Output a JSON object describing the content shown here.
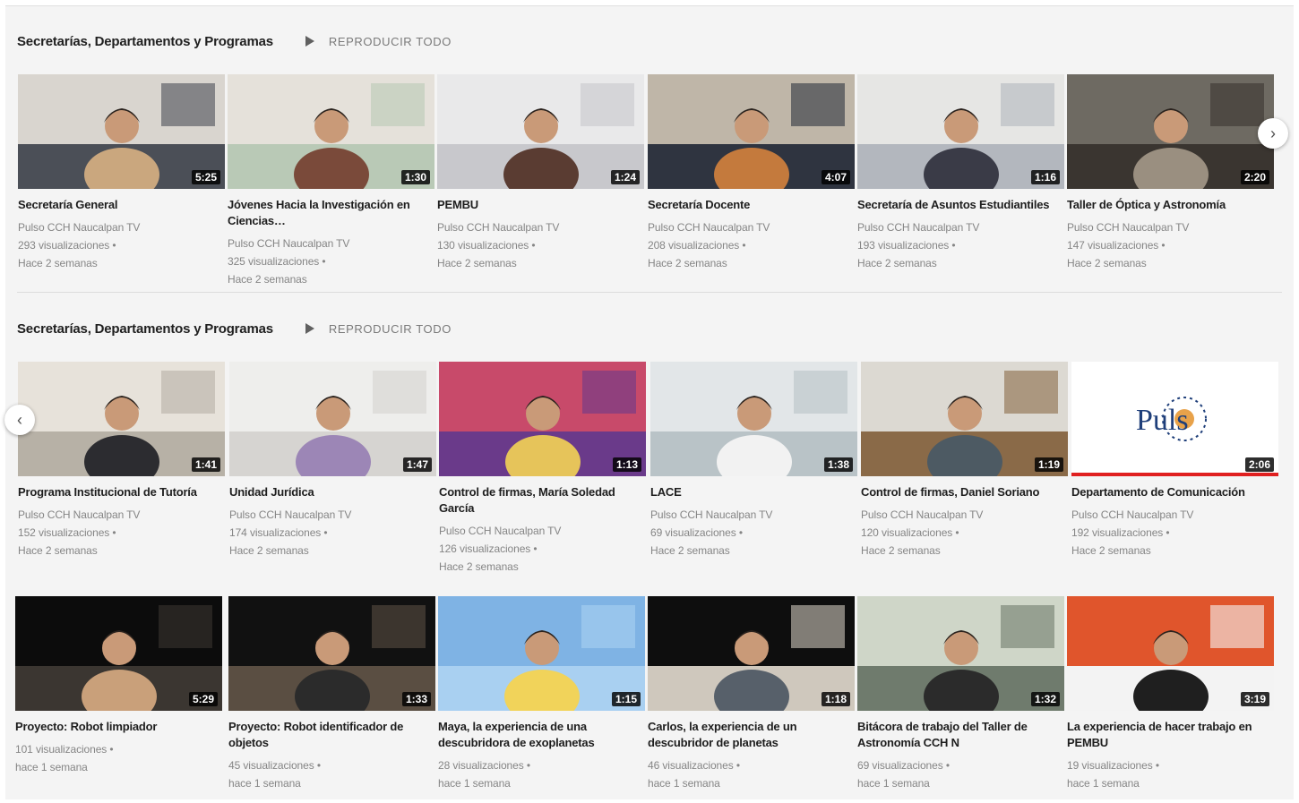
{
  "shelves": [
    {
      "title": "Secretarías, Departamentos y Programas",
      "play_all": "REPRODUCIR TODO",
      "rows": [
        [
          {
            "title": "Secretaría General",
            "channel": "Pulso CCH Naucalpan TV",
            "views": "293 visualizaciones •",
            "age": "Hace 2 semanas",
            "duration": "5:25"
          },
          {
            "title": "Jóvenes Hacia la Investigación en Ciencias…",
            "channel": "Pulso CCH Naucalpan TV",
            "views": "325 visualizaciones •",
            "age": "Hace 2 semanas",
            "duration": "1:30"
          },
          {
            "title": "PEMBU",
            "channel": "Pulso CCH Naucalpan TV",
            "views": "130 visualizaciones •",
            "age": "Hace 2 semanas",
            "duration": "1:24"
          },
          {
            "title": "Secretaría Docente",
            "channel": "Pulso CCH Naucalpan TV",
            "views": "208 visualizaciones •",
            "age": "Hace 2 semanas",
            "duration": "4:07"
          },
          {
            "title": "Secretaría de Asuntos Estudiantiles",
            "channel": "Pulso CCH Naucalpan TV",
            "views": "193 visualizaciones •",
            "age": "Hace 2 semanas",
            "duration": "1:16"
          },
          {
            "title": "Taller de Óptica y Astronomía",
            "channel": "Pulso CCH Naucalpan TV",
            "views": "147 visualizaciones •",
            "age": "Hace 2 semanas",
            "duration": "2:20"
          }
        ]
      ]
    },
    {
      "title": "Secretarías, Departamentos y Programas",
      "play_all": "REPRODUCIR TODO",
      "rows": [
        [
          {
            "title": "Programa Institucional de Tutoría",
            "channel": "Pulso CCH Naucalpan TV",
            "views": "152 visualizaciones •",
            "age": "Hace 2 semanas",
            "duration": "1:41"
          },
          {
            "title": "Unidad Jurídica",
            "channel": "Pulso CCH Naucalpan TV",
            "views": "174 visualizaciones •",
            "age": "Hace 2 semanas",
            "duration": "1:47"
          },
          {
            "title": "Control de firmas, María Soledad García",
            "channel": "Pulso CCH Naucalpan TV",
            "views": "126 visualizaciones •",
            "age": "Hace 2 semanas",
            "duration": "1:13"
          },
          {
            "title": "LACE",
            "channel": "Pulso CCH Naucalpan TV",
            "views": "69 visualizaciones •",
            "age": "Hace 2 semanas",
            "duration": "1:38"
          },
          {
            "title": "Control de firmas, Daniel Soriano",
            "channel": "Pulso CCH Naucalpan TV",
            "views": "120 visualizaciones •",
            "age": "Hace 2 semanas",
            "duration": "1:19"
          },
          {
            "title": "Departamento de Comunicación",
            "channel": "Pulso CCH Naucalpan TV",
            "views": "192 visualizaciones •",
            "age": "Hace 2 semanas",
            "duration": "2:06",
            "logo": "Puls",
            "progress": 1.0
          }
        ],
        [
          {
            "title": "Proyecto: Robot limpiador",
            "views": "101 visualizaciones •",
            "age": "hace 1 semana",
            "duration": "5:29"
          },
          {
            "title": "Proyecto: Robot identificador de objetos",
            "views": "45 visualizaciones •",
            "age": "hace 1 semana",
            "duration": "1:33"
          },
          {
            "title": "Maya, la experiencia de una descubridora de exoplanetas",
            "views": "28 visualizaciones •",
            "age": "hace 1 semana",
            "duration": "1:15"
          },
          {
            "title": "Carlos, la experiencia de un descubridor de planetas",
            "views": "46 visualizaciones •",
            "age": "hace 1 semana",
            "duration": "1:18"
          },
          {
            "title": "Bitácora de trabajo del Taller de Astronomía CCH N",
            "views": "69 visualizaciones •",
            "age": "hace 1 semana",
            "duration": "1:32"
          },
          {
            "title": "La experiencia de hacer trabajo en PEMBU",
            "views": "19 visualizaciones •",
            "age": "hace 1 semana",
            "duration": "3:19"
          }
        ]
      ]
    }
  ],
  "icons": {
    "next": "chevron-right-icon",
    "prev": "chevron-left-icon",
    "play": "play-icon"
  },
  "colors": {
    "progress": "#e02020",
    "background": "#f4f4f4"
  }
}
